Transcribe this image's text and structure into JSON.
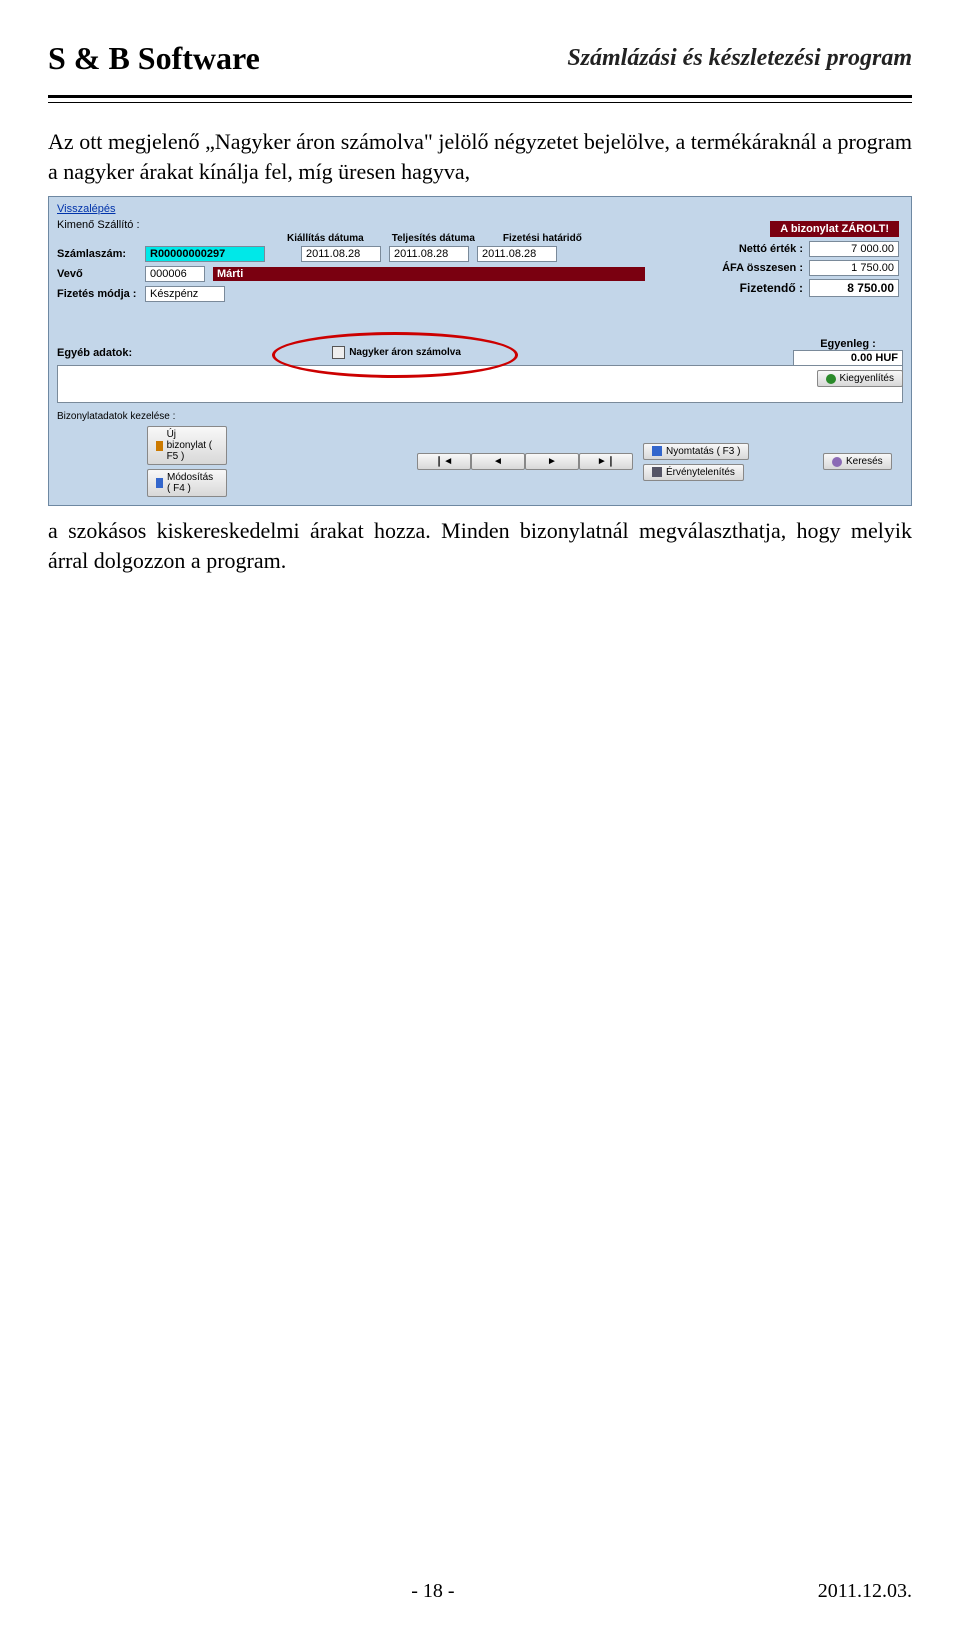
{
  "header": {
    "company": "S & B Software",
    "product": "Számlázási és készletezési program"
  },
  "para1": "Az ott megjelenő „Nagyker áron számolva\" jelölő négyzetet bejelölve, a termékáraknál a program a nagyker árakat kínálja fel, míg üresen hagyva,",
  "para2": "a szokásos kiskereskedelmi árakat hozza. Minden bizonylatnál megválaszthatja, hogy melyik árral dolgozzon a program.",
  "shot": {
    "back": "Visszalépés",
    "kimeno": "Kimenő Szállító :",
    "zarolt": "A bizonylat ZÁROLT!",
    "szamlaszam_lbl": "Számlaszám:",
    "szamlaszam_val": "R00000000297",
    "dates_hdr": {
      "a": "Kiállítás dátuma",
      "b": "Teljesítés dátuma",
      "c": "Fizetési határidő"
    },
    "dates_val": {
      "a": "2011.08.28",
      "b": "2011.08.28",
      "c": "2011.08.28"
    },
    "vevo_lbl": "Vevő",
    "vevo_code": "000006",
    "vevo_name": "Márti",
    "fizmod_lbl": "Fizetés módja :",
    "fizmod_val": "Készpénz",
    "totals": {
      "netto_lbl": "Nettó érték :",
      "netto_val": "7 000.00",
      "afa_lbl": "ÁFA összesen :",
      "afa_val": "1 750.00",
      "fiz_lbl": "Fizetendő :",
      "fiz_val": "8 750.00"
    },
    "egyeb_lbl": "Egyéb adatok:",
    "nagyker_lbl": "Nagyker áron számolva",
    "egyenleg_lbl": "Egyenleg :",
    "egyenleg_val": "0.00 HUF",
    "kiegy_btn": "Kiegyenlítés",
    "bizkez_lbl": "Bizonylatadatok kezelése :",
    "buttons": {
      "uj": "Új bizonylat ( F5 )",
      "mod": "Módosítás ( F4 )",
      "nyom": "Nyomtatás ( F3 )",
      "erv": "Érvénytelenítés",
      "keres": "Keresés"
    },
    "nav": {
      "first": "❘◄",
      "prev": "◄",
      "next": "►",
      "last": "►❘"
    }
  },
  "footer": {
    "page": "- 18 -",
    "date": "2011.12.03."
  }
}
